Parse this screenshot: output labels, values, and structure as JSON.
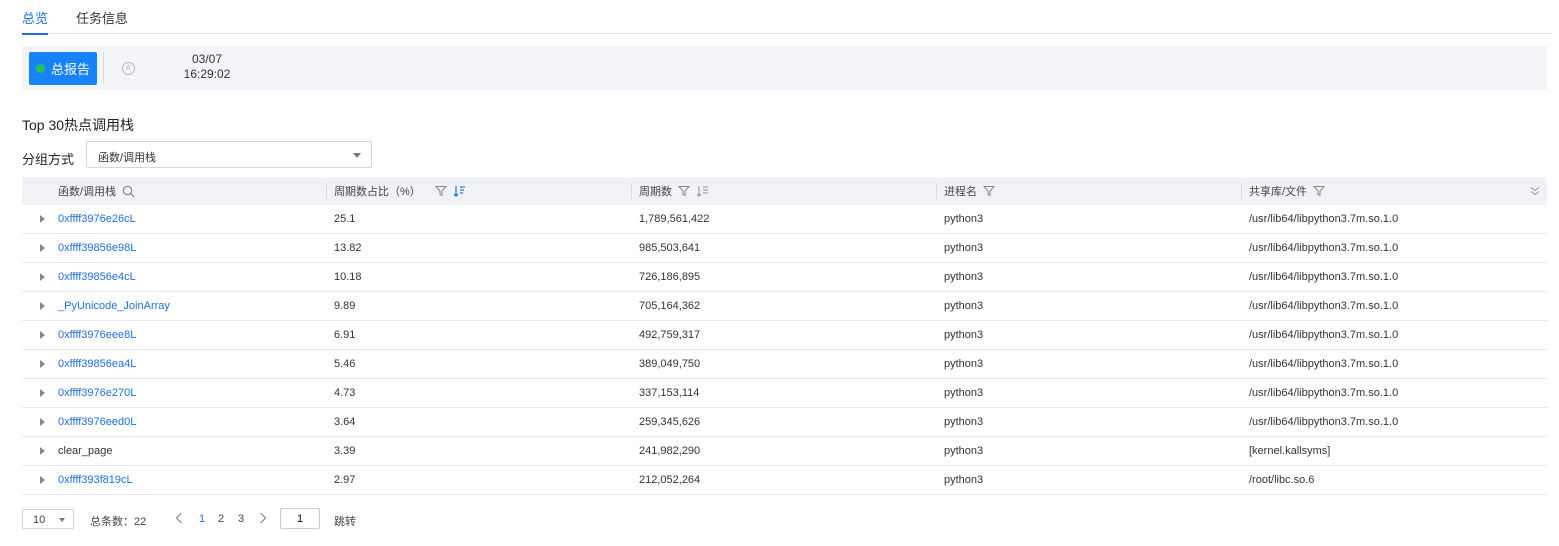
{
  "tabs": [
    {
      "label": "总览",
      "active": true
    },
    {
      "label": "任务信息",
      "active": false
    }
  ],
  "report": {
    "button_label": "总报告",
    "status_color": "#22c35e",
    "compare_icon_text": "A",
    "date": "03/07",
    "time": "16:29:02"
  },
  "section_title": "Top 30热点调用栈",
  "group": {
    "label": "分组方式",
    "selected": "函数/调用栈"
  },
  "table": {
    "columns": [
      {
        "label": "函数/调用栈",
        "icon": "search-icon"
      },
      {
        "label": "周期数占比（%）",
        "icons": [
          "filter-icon",
          "sort-desc-icon"
        ]
      },
      {
        "label": "周期数",
        "icons": [
          "filter-icon",
          "sort-icon"
        ]
      },
      {
        "label": "进程名",
        "icons": [
          "filter-icon"
        ]
      },
      {
        "label": "共享库/文件",
        "icons": [
          "filter-icon",
          "column-collapse-icon"
        ]
      }
    ],
    "rows": [
      {
        "func": "0xffff3976e26cL",
        "pct": "25.1",
        "cycles": "1,789,561,422",
        "proc": "python3",
        "lib": "/usr/lib64/libpython3.7m.so.1.0",
        "link": true
      },
      {
        "func": "0xffff39856e98L",
        "pct": "13.82",
        "cycles": "985,503,641",
        "proc": "python3",
        "lib": "/usr/lib64/libpython3.7m.so.1.0",
        "link": true
      },
      {
        "func": "0xffff39856e4cL",
        "pct": "10.18",
        "cycles": "726,186,895",
        "proc": "python3",
        "lib": "/usr/lib64/libpython3.7m.so.1.0",
        "link": true
      },
      {
        "func": "_PyUnicode_JoinArray",
        "pct": "9.89",
        "cycles": "705,164,362",
        "proc": "python3",
        "lib": "/usr/lib64/libpython3.7m.so.1.0",
        "link": true
      },
      {
        "func": "0xffff3976eee8L",
        "pct": "6.91",
        "cycles": "492,759,317",
        "proc": "python3",
        "lib": "/usr/lib64/libpython3.7m.so.1.0",
        "link": true
      },
      {
        "func": "0xffff39856ea4L",
        "pct": "5.46",
        "cycles": "389,049,750",
        "proc": "python3",
        "lib": "/usr/lib64/libpython3.7m.so.1.0",
        "link": true
      },
      {
        "func": "0xffff3976e270L",
        "pct": "4.73",
        "cycles": "337,153,114",
        "proc": "python3",
        "lib": "/usr/lib64/libpython3.7m.so.1.0",
        "link": true
      },
      {
        "func": "0xffff3976eed0L",
        "pct": "3.64",
        "cycles": "259,345,626",
        "proc": "python3",
        "lib": "/usr/lib64/libpython3.7m.so.1.0",
        "link": true
      },
      {
        "func": "clear_page",
        "pct": "3.39",
        "cycles": "241,982,290",
        "proc": "python3",
        "lib": "[kernel.kallsyms]",
        "link": false
      },
      {
        "func": "0xffff393f819cL",
        "pct": "2.97",
        "cycles": "212,052,264",
        "proc": "python3",
        "lib": "/root/libc.so.6",
        "link": true
      }
    ]
  },
  "pagination": {
    "page_size": "10",
    "total_text": "总条数：22",
    "pages": [
      "1",
      "2",
      "3"
    ],
    "current_page": "1",
    "jump_value": "1",
    "jump_label": "跳转"
  },
  "colors": {
    "accent": "#1e6fe0",
    "report_button": "#1683fb"
  }
}
